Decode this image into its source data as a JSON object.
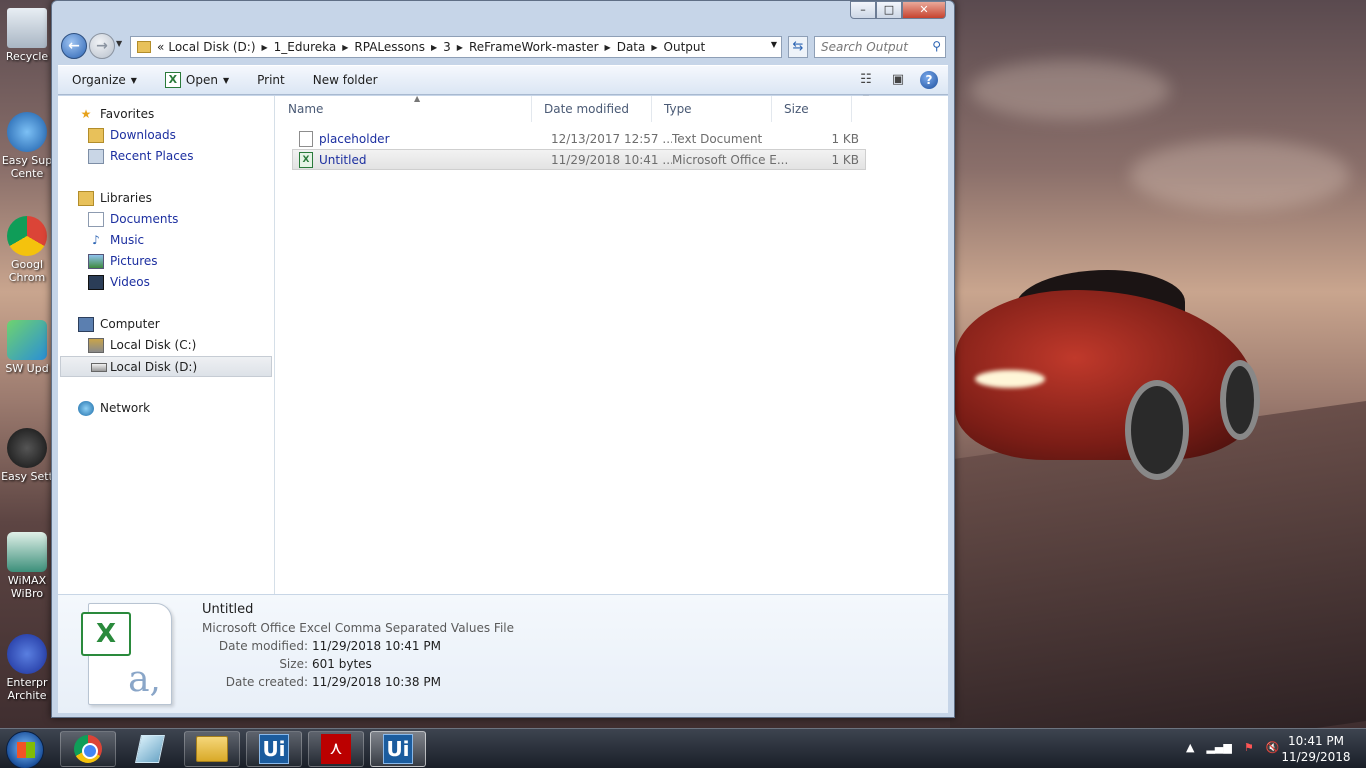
{
  "desktop": {
    "icons": [
      {
        "label": "Recycle"
      },
      {
        "label": "Easy Sup Cente"
      },
      {
        "label": "Googl Chrom"
      },
      {
        "label": "SW Upd"
      },
      {
        "label": "Easy Sett"
      },
      {
        "label": "WiMAX WiBro"
      },
      {
        "label": "Enterpr Archite"
      }
    ]
  },
  "window": {
    "caption": {
      "minimize": "–",
      "maximize": "□",
      "close": "✕"
    },
    "address": {
      "overflow": "«",
      "crumbs": [
        "Local Disk (D:)",
        "1_Edureka",
        "RPALessons",
        "3",
        "ReFrameWork-master",
        "Data",
        "Output"
      ]
    },
    "search": {
      "placeholder": "Search Output"
    },
    "toolbar": {
      "organize": "Organize",
      "open": "Open",
      "print": "Print",
      "new_folder": "New folder"
    },
    "nav": {
      "favorites": "Favorites",
      "downloads": "Downloads",
      "recent_places": "Recent Places",
      "libraries": "Libraries",
      "documents": "Documents",
      "music": "Music",
      "pictures": "Pictures",
      "videos": "Videos",
      "computer": "Computer",
      "local_c": "Local Disk (C:)",
      "local_d": "Local Disk (D:)",
      "network": "Network"
    },
    "columns": {
      "name": "Name",
      "date": "Date modified",
      "type": "Type",
      "size": "Size"
    },
    "files": [
      {
        "name": "placeholder",
        "date": "12/13/2017 12:57 ...",
        "type": "Text Document",
        "size": "1 KB"
      },
      {
        "name": "Untitled",
        "date": "11/29/2018 10:41 ...",
        "type": "Microsoft Office E...",
        "size": "1 KB"
      }
    ],
    "details": {
      "title": "Untitled",
      "subtitle": "Microsoft Office Excel Comma Separated Values File",
      "date_modified_label": "Date modified:",
      "date_modified": "11/29/2018 10:41 PM",
      "size_label": "Size:",
      "size": "601 bytes",
      "date_created_label": "Date created:",
      "date_created": "11/29/2018 10:38 PM"
    }
  },
  "taskbar": {
    "ui1": "Ui",
    "ui2": "Ui",
    "clock_time": "10:41 PM",
    "clock_date": "11/29/2018"
  }
}
